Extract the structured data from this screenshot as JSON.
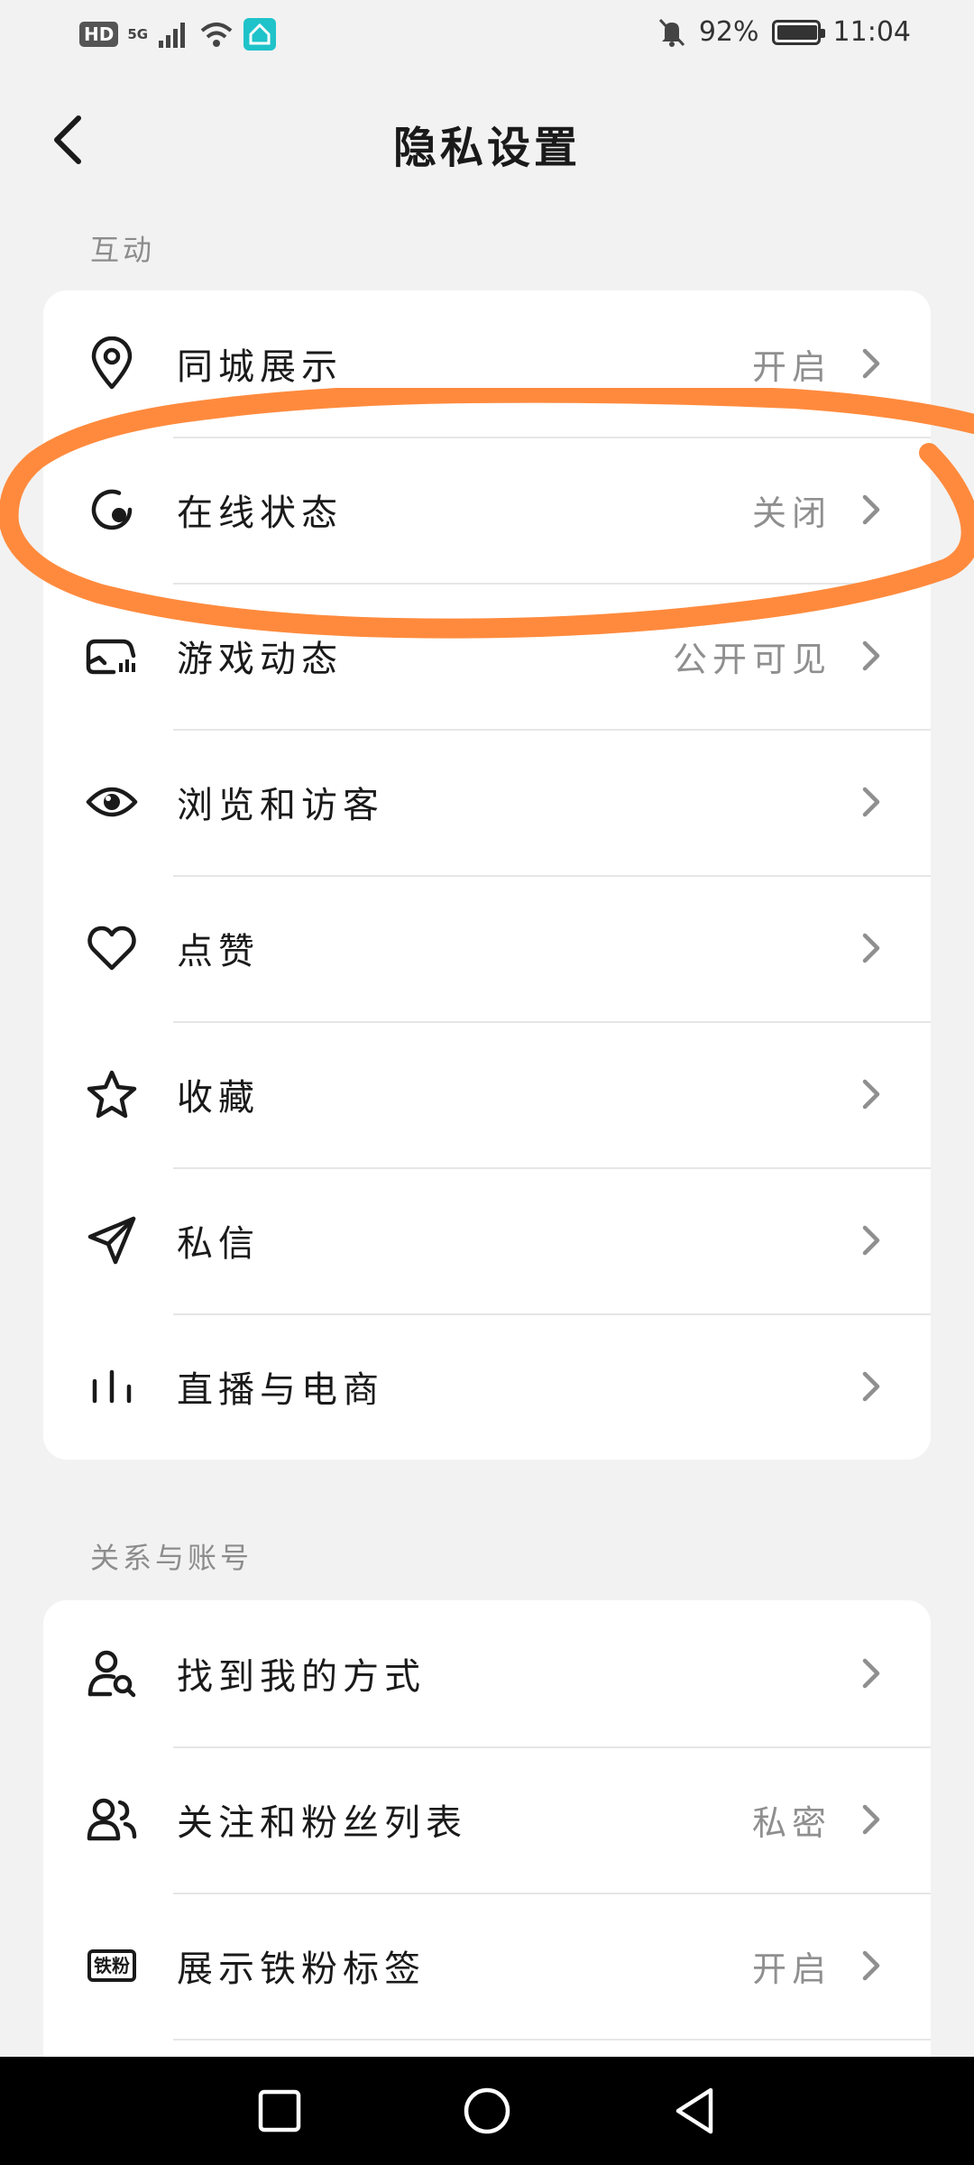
{
  "status_bar": {
    "hd": "HD",
    "network": "5G",
    "battery": "92%",
    "time": "11:04"
  },
  "header": {
    "title": "隐私设置"
  },
  "sections": [
    {
      "label": "互动",
      "items": [
        {
          "icon": "location-pin-icon",
          "label": "同城展示",
          "value": "开启"
        },
        {
          "icon": "online-status-icon",
          "label": "在线状态",
          "value": "关闭"
        },
        {
          "icon": "game-controller-icon",
          "label": "游戏动态",
          "value": "公开可见"
        },
        {
          "icon": "eye-icon",
          "label": "浏览和访客",
          "value": ""
        },
        {
          "icon": "heart-icon",
          "label": "点赞",
          "value": ""
        },
        {
          "icon": "star-icon",
          "label": "收藏",
          "value": ""
        },
        {
          "icon": "send-icon",
          "label": "私信",
          "value": ""
        },
        {
          "icon": "live-bars-icon",
          "label": "直播与电商",
          "value": ""
        }
      ]
    },
    {
      "label": "关系与账号",
      "items": [
        {
          "icon": "find-user-icon",
          "label": "找到我的方式",
          "value": ""
        },
        {
          "icon": "users-icon",
          "label": "关注和粉丝列表",
          "value": "私密"
        },
        {
          "icon": "tiefen-badge-icon",
          "badge_text": "铁粉",
          "label": "展示铁粉标签",
          "value": "开启"
        }
      ]
    }
  ],
  "annotation": {
    "color": "#ff8a3d",
    "target": "在线状态"
  },
  "nav_bar": {
    "buttons": [
      "recent-apps-icon",
      "home-icon",
      "back-triangle-icon"
    ]
  }
}
